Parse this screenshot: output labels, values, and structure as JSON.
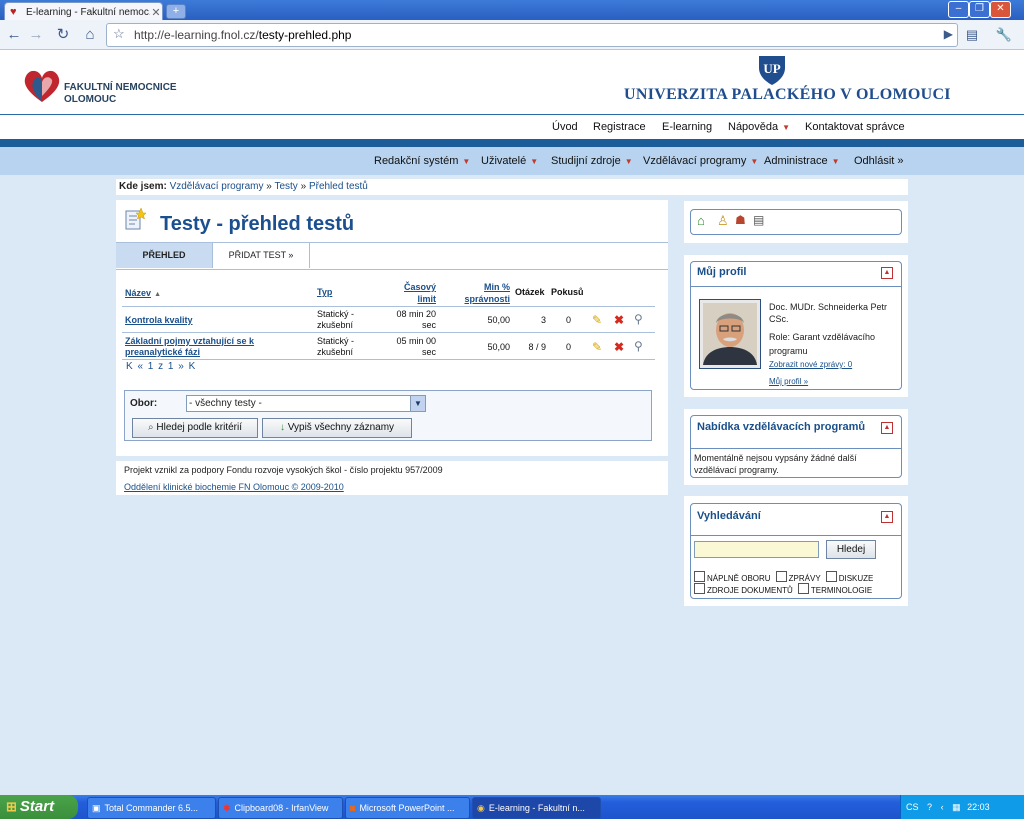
{
  "browser": {
    "tab_title": "E-learning - Fakultní nemoc...",
    "url_host": "http://e-learning.fnol.cz/",
    "url_path": "testy-prehled.php"
  },
  "header": {
    "left_logo_line1": "FAKULTNÍ NEMOCNICE",
    "left_logo_line2": "OLOMOUC",
    "university": "UNIVERZITA PALACKÉHO V OLOMOUCI"
  },
  "topnav": [
    "Úvod",
    "Registrace",
    "E-learning",
    "Nápověda",
    "Kontaktovat správce"
  ],
  "mainnav": [
    "Redakční systém",
    "Uživatelé",
    "Studijní zdroje",
    "Vzdělávací programy",
    "Administrace",
    "Odhlásit »"
  ],
  "breadcrumb": {
    "label": "Kde jsem:",
    "items": [
      "Vzdělávací programy",
      "Testy",
      "Přehled testů"
    ],
    "sep": "»"
  },
  "page": {
    "title": "Testy - přehled testů",
    "tabs": [
      "PŘEHLED",
      "PŘIDAT TEST »"
    ]
  },
  "table": {
    "headers": {
      "name": "Název",
      "name_sort": "▲",
      "type": "Typ",
      "time_l1": "Časový",
      "time_l2": "limit",
      "min_l1": "Min %",
      "min_l2": "správnosti",
      "questions": "Otázek",
      "attempts": "Pokusů"
    },
    "rows": [
      {
        "name_l1": "Kontrola kvality",
        "name_l2": "",
        "type_l1": "Statický -",
        "type_l2": "zkušební",
        "time_l1": "08 min 20",
        "time_l2": "sec",
        "min": "50,00",
        "questions": "3",
        "attempts": "0"
      },
      {
        "name_l1": "Základní pojmy vztahující se k",
        "name_l2": "preanalytické fázi",
        "type_l1": "Statický -",
        "type_l2": "zkušební",
        "time_l1": "05 min 00",
        "time_l2": "sec",
        "min": "50,00",
        "questions": "8 / 9",
        "attempts": "0"
      }
    ],
    "pager": "K « 1 z 1 » K"
  },
  "filter": {
    "label": "Obor:",
    "selected": "- všechny testy -",
    "search_button": "Hledej podle kritérií",
    "all_button": "Vypiš všechny záznamy"
  },
  "footer": {
    "line1": "Projekt vznikl za podpory Fondu rozvoje vysokých škol - číslo projektu 957/2009",
    "line2": "Oddělení klinické biochemie FN Olomouc © 2009-2010"
  },
  "profile": {
    "heading": "Můj profil",
    "name_l1": "Doc. MUDr. Schneiderka Petr",
    "name_l2": "CSc.",
    "role_l1": "Role: Garant vzdělávacího",
    "role_l2": "programu",
    "new_messages": "Zobrazit nové zprávy: 0",
    "my_profile": "Můj profil »"
  },
  "programs": {
    "heading": "Nabídka vzdělávacích programů",
    "text_l1": "Momentálně nejsou vypsány žádné další",
    "text_l2": "vzdělávací programy."
  },
  "search": {
    "heading": "Vyhledávání",
    "button": "Hledej",
    "opt1": "NÁPLNĚ OBORU",
    "opt2": "ZPRÁVY",
    "opt3": "DISKUZE",
    "opt4": "ZDROJE DOKUMENTŮ",
    "opt5": "TERMINOLOGIE"
  },
  "taskbar": {
    "start": "Start",
    "items": [
      "Total Commander 6.5...",
      "Clipboard08 - IrfanView",
      "Microsoft PowerPoint ...",
      "E-learning - Fakultní n..."
    ],
    "lang": "CS",
    "clock": "22:03"
  },
  "colors": {
    "accent": "#1b4f8f",
    "nav_bg": "#b7d3ef",
    "page_bg": "#dbe9f6",
    "dark_bar": "#1c5d99"
  }
}
